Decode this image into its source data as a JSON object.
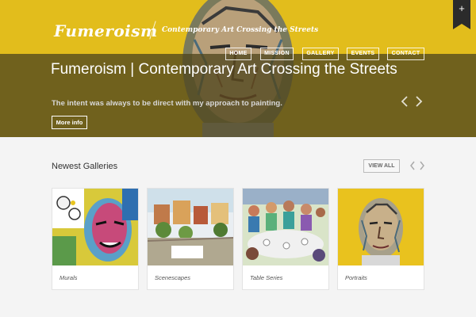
{
  "brand": {
    "logo": "Fumeroism",
    "tagline": "Contemporary Art Crossing the Streets"
  },
  "nav": {
    "items": [
      {
        "label": "HOME",
        "active": true
      },
      {
        "label": "MISSION"
      },
      {
        "label": "GALLERY"
      },
      {
        "label": "EVENTS"
      },
      {
        "label": "CONTACT"
      }
    ]
  },
  "hero": {
    "title": "Fumeroism | Contemporary Art Crossing the Streets",
    "subtitle": "The intent was always to be direct with my approach to painting.",
    "button_label": "More info"
  },
  "corner_ribbon": {
    "icon": "plus-icon",
    "glyph": "+"
  },
  "galleries": {
    "title": "Newest Galleries",
    "view_all_label": "VIEW ALL",
    "items": [
      {
        "caption": "Murals"
      },
      {
        "caption": "Scenescapes"
      },
      {
        "caption": "Table Series"
      },
      {
        "caption": "Portraits"
      }
    ]
  },
  "colors": {
    "hero_yellow": "#e2bd1c",
    "band_overlay": "#50461e",
    "section_bg": "#f4f4f4"
  }
}
